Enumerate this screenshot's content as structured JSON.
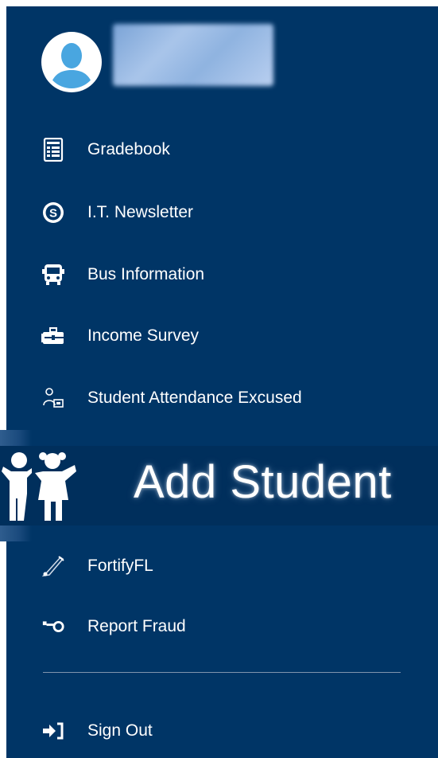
{
  "colors": {
    "panel_background": "#003566",
    "text": "#ffffff",
    "divider": "#7f95ad",
    "avatar_accent": "#49a6e0"
  },
  "menu": {
    "items": [
      {
        "label": "Gradebook",
        "icon": "gradebook-icon"
      },
      {
        "label": "I.T. Newsletter",
        "icon": "s-circle-icon"
      },
      {
        "label": "Bus Information",
        "icon": "bus-icon"
      },
      {
        "label": "Income Survey",
        "icon": "briefcase-icon"
      },
      {
        "label": "Student Attendance Excused",
        "icon": "attendance-icon"
      },
      {
        "label": "FortifyFL",
        "icon": "megaphone-icon"
      },
      {
        "label": "Report Fraud",
        "icon": "report-fraud-icon"
      }
    ],
    "sign_out": {
      "label": "Sign Out",
      "icon": "sign-out-icon"
    }
  },
  "add_student": {
    "label": "Add Student",
    "icon": "children-icon"
  }
}
